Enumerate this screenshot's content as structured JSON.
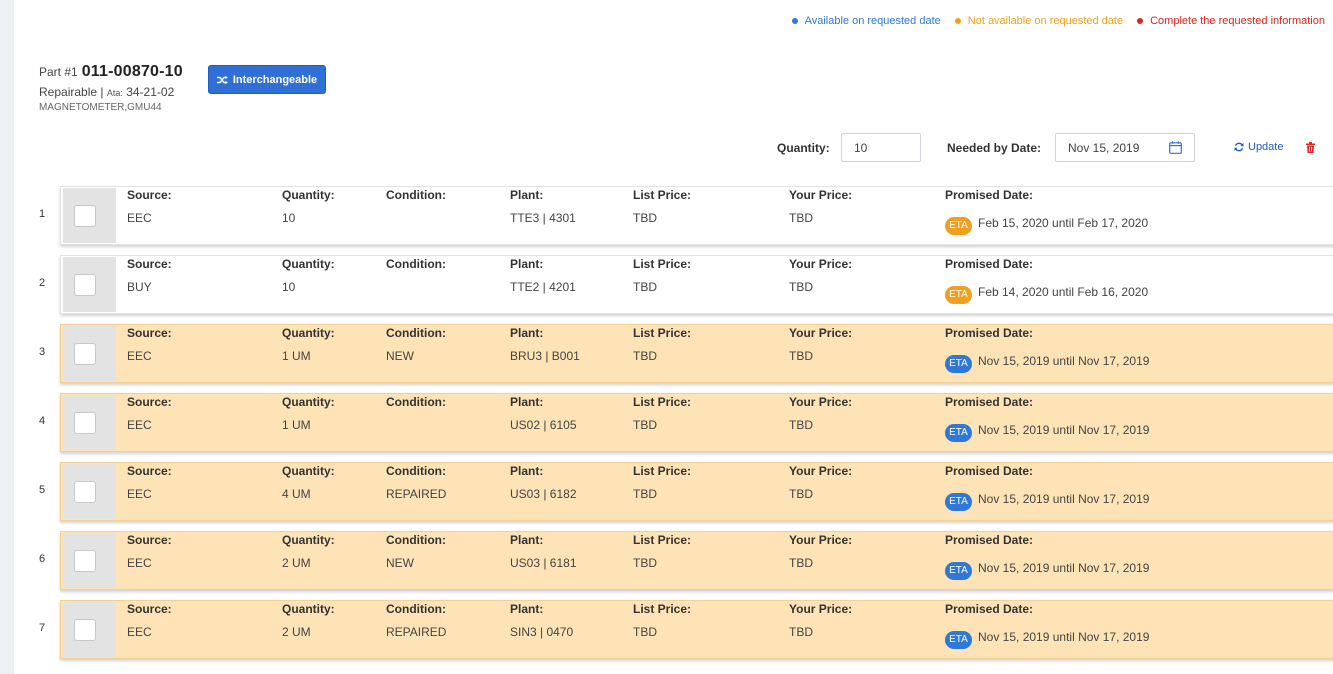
{
  "legend": [
    {
      "label": "Available on requested date",
      "color": "#2f78d8"
    },
    {
      "label": "Not available on requested date",
      "color": "#f0a01e"
    },
    {
      "label": "Complete the requested information",
      "color": "#d9261c"
    }
  ],
  "part": {
    "prefix": "Part #1",
    "number": "011-00870-10",
    "type": "Repairable |",
    "ata_label": "Ata:",
    "ata_value": "34-21-02",
    "description": "MAGNETOMETER,GMU44",
    "interchange_label": "Interchangeable"
  },
  "controls": {
    "quantity_label": "Quantity:",
    "quantity_value": "10",
    "date_label": "Needed by Date:",
    "date_value": "Nov 15, 2019",
    "update_label": "Update"
  },
  "columns": {
    "source": "Source:",
    "quantity": "Quantity:",
    "condition": "Condition:",
    "plant": "Plant:",
    "list_price": "List Price:",
    "your_price": "Your Price:",
    "promised_date": "Promised Date:"
  },
  "eta_label": "ETA",
  "rows": [
    {
      "num": "1",
      "status": "available",
      "source": "EEC",
      "quantity": "10",
      "condition": "",
      "plant": "TTE3 | 4301",
      "list_price": "TBD",
      "your_price": "TBD",
      "eta_color": "orange",
      "promised": "Feb 15, 2020 until Feb 17, 2020"
    },
    {
      "num": "2",
      "status": "available",
      "source": "BUY",
      "quantity": "10",
      "condition": "",
      "plant": "TTE2 | 4201",
      "list_price": "TBD",
      "your_price": "TBD",
      "eta_color": "orange",
      "promised": "Feb 14, 2020 until Feb 16, 2020"
    },
    {
      "num": "3",
      "status": "not_available",
      "source": "EEC",
      "quantity": "1 UM",
      "condition": "NEW",
      "plant": "BRU3 | B001",
      "list_price": "TBD",
      "your_price": "TBD",
      "eta_color": "blue",
      "promised": "Nov 15, 2019 until Nov 17, 2019"
    },
    {
      "num": "4",
      "status": "not_available",
      "source": "EEC",
      "quantity": "1 UM",
      "condition": "",
      "plant": "US02 | 6105",
      "list_price": "TBD",
      "your_price": "TBD",
      "eta_color": "blue",
      "promised": "Nov 15, 2019 until Nov 17, 2019"
    },
    {
      "num": "5",
      "status": "not_available",
      "source": "EEC",
      "quantity": "4 UM",
      "condition": "REPAIRED",
      "plant": "US03 | 6182",
      "list_price": "TBD",
      "your_price": "TBD",
      "eta_color": "blue",
      "promised": "Nov 15, 2019 until Nov 17, 2019"
    },
    {
      "num": "6",
      "status": "not_available",
      "source": "EEC",
      "quantity": "2 UM",
      "condition": "NEW",
      "plant": "US03 | 6181",
      "list_price": "TBD",
      "your_price": "TBD",
      "eta_color": "blue",
      "promised": "Nov 15, 2019 until Nov 17, 2019"
    },
    {
      "num": "7",
      "status": "not_available",
      "source": "EEC",
      "quantity": "2 UM",
      "condition": "REPAIRED",
      "plant": "SIN3 | 0470",
      "list_price": "TBD",
      "your_price": "TBD",
      "eta_color": "blue",
      "promised": "Nov 15, 2019 until Nov 17, 2019"
    }
  ]
}
